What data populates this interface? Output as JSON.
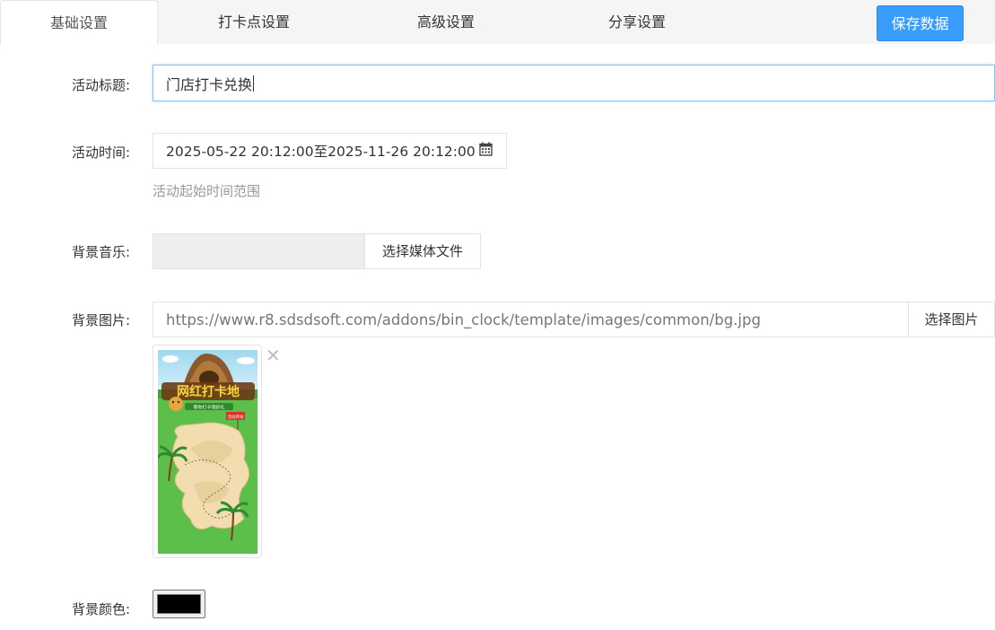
{
  "tabs": [
    {
      "label": "基础设置",
      "active": true
    },
    {
      "label": "打卡点设置",
      "active": false
    },
    {
      "label": "高级设置",
      "active": false
    },
    {
      "label": "分享设置",
      "active": false
    }
  ],
  "save_button": "保存数据",
  "form": {
    "title_label": "活动标题:",
    "title_value": "门店打卡兑换",
    "time_label": "活动时间:",
    "time_value": "2025-05-22 20:12:00至2025-11-26 20:12:00",
    "time_hint": "活动起始时间范围",
    "music_label": "背景音乐:",
    "music_value": "",
    "music_button": "选择媒体文件",
    "image_label": "背景图片:",
    "image_value": "https://www.r8.sdsdsoft.com/addons/bin_clock/template/images/common/bg.jpg",
    "image_button": "选择图片",
    "color_label": "背景颜色:",
    "color_value": "#000000"
  },
  "thumbnail": {
    "title_text": "网红打卡地",
    "subtitle_text": "等你打卡领好礼",
    "flag_text": "活动开始"
  },
  "colors": {
    "accent": "#3a9dfb",
    "grass": "#5cbf4a",
    "map": "#f1ddb0"
  }
}
